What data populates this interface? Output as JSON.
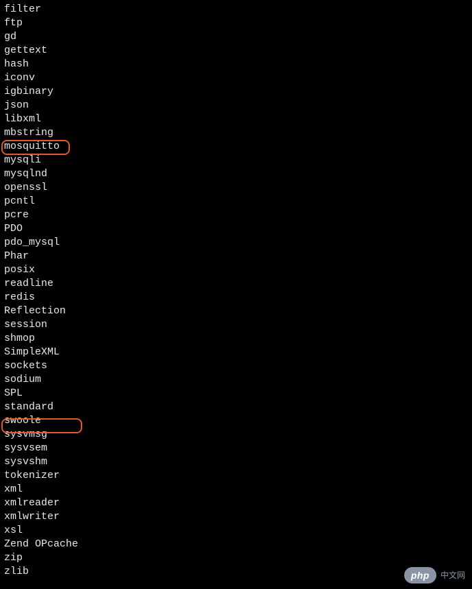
{
  "terminal": {
    "lines": [
      "filter",
      "ftp",
      "gd",
      "gettext",
      "hash",
      "iconv",
      "igbinary",
      "json",
      "libxml",
      "mbstring",
      "mosquitto",
      "mysqli",
      "mysqlnd",
      "openssl",
      "pcntl",
      "pcre",
      "PDO",
      "pdo_mysql",
      "Phar",
      "posix",
      "readline",
      "redis",
      "Reflection",
      "session",
      "shmop",
      "SimpleXML",
      "sockets",
      "sodium",
      "SPL",
      "standard",
      "swoole",
      "sysvmsg",
      "sysvsem",
      "sysvshm",
      "tokenizer",
      "xml",
      "xmlreader",
      "xmlwriter",
      "xsl",
      "Zend OPcache",
      "zip",
      "zlib"
    ]
  },
  "highlights": {
    "first": "mosquitto",
    "second": "swoole"
  },
  "watermark": {
    "badge": "php",
    "text": "中文网"
  }
}
